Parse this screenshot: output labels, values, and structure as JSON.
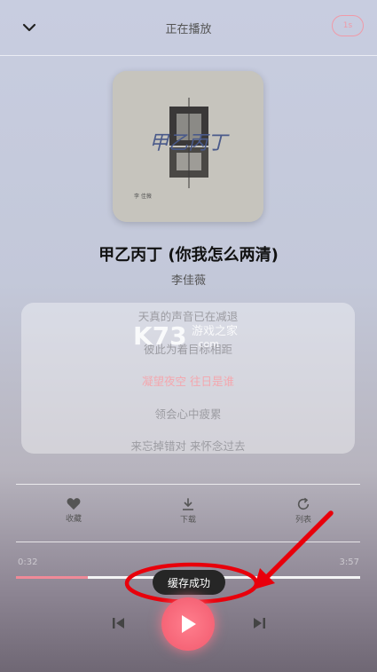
{
  "header": {
    "title": "正在播放",
    "badge": "1s"
  },
  "cover": {
    "title_art": "甲乙丙丁",
    "artist_small": "李 佳薇"
  },
  "song": {
    "title": "甲乙丙丁 (你我怎么两清)",
    "artist": "李佳薇"
  },
  "lyrics": [
    {
      "text": "天真的声音已在减退",
      "active": false
    },
    {
      "text": "彼此为着目标相距",
      "active": false
    },
    {
      "text": "凝望夜空 往日是谁",
      "active": true
    },
    {
      "text": "领会心中疲累",
      "active": false
    },
    {
      "text": "来忘掉错对 来怀念过去",
      "active": false
    }
  ],
  "watermark": {
    "main": "K73",
    "sub": "游戏之家",
    "domain": ".com"
  },
  "actions": {
    "favorite": "收藏",
    "download": "下载",
    "loop": "列表"
  },
  "time": {
    "elapsed": "0:32",
    "total": "3:57"
  },
  "playback": {
    "progress_fraction": 0.21
  },
  "toast": "缓存成功",
  "colors": {
    "accent": "#f7687a",
    "annotation": "#e8000b"
  }
}
